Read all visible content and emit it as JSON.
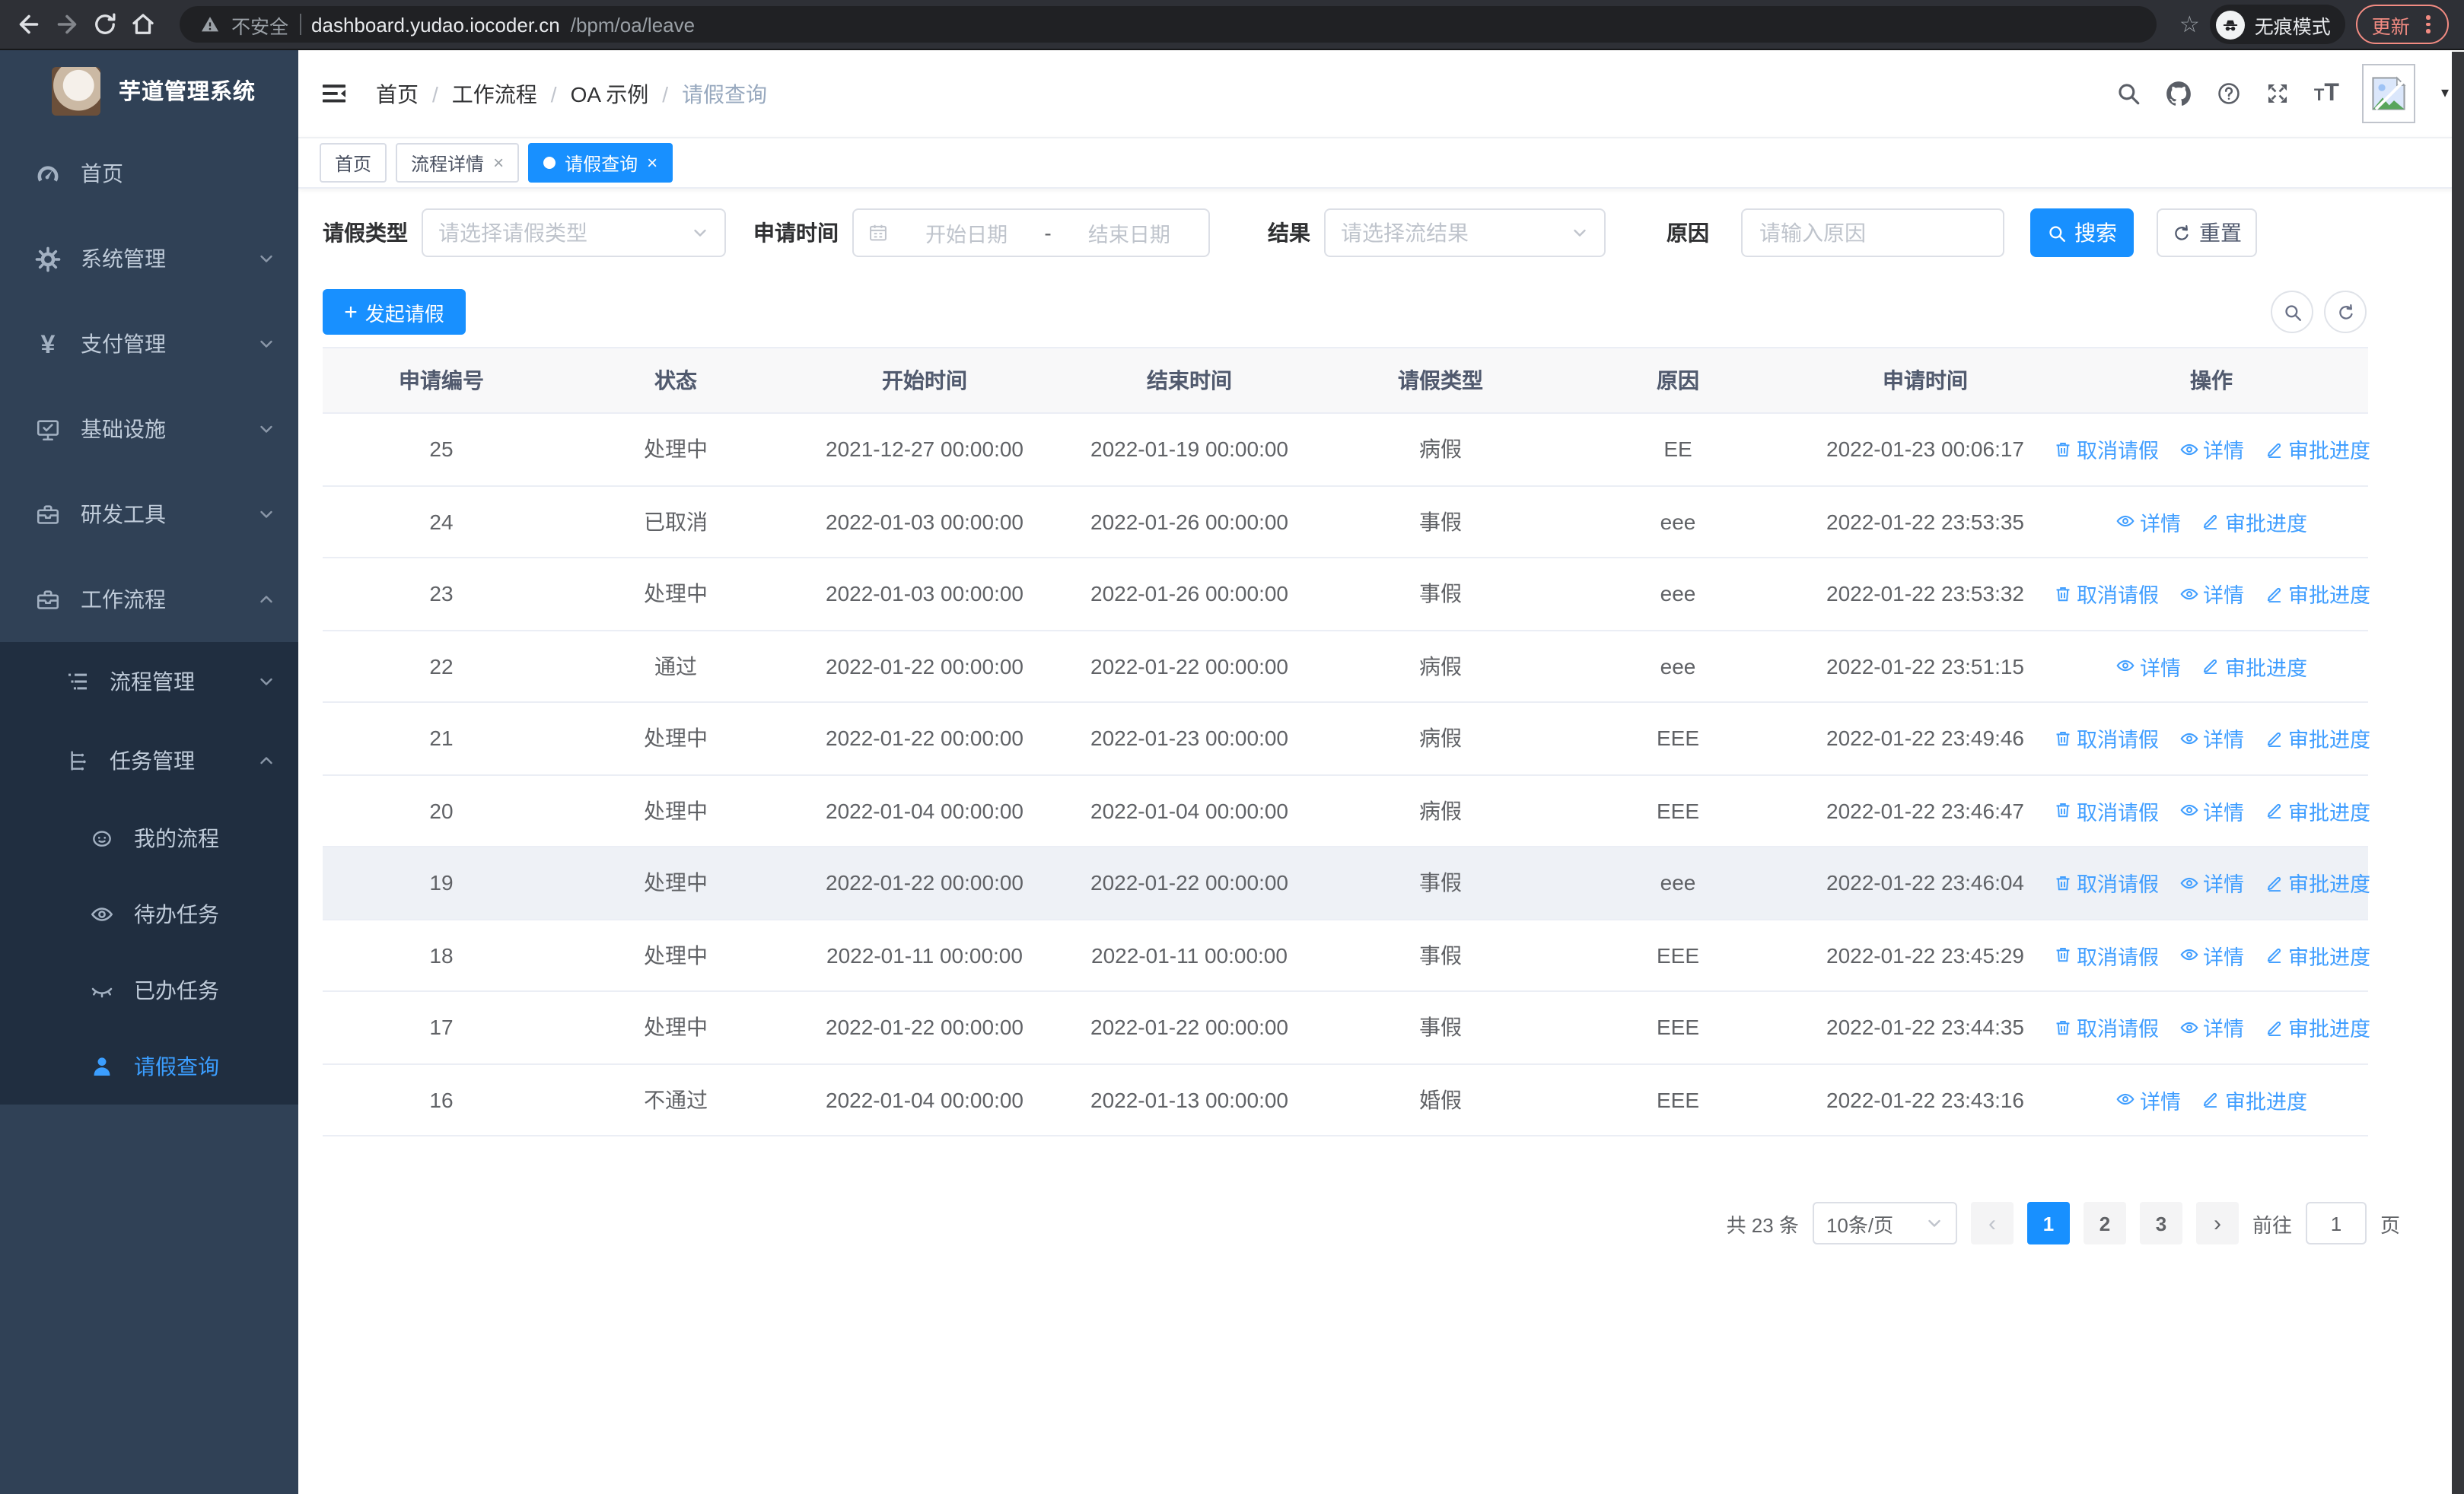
{
  "browser": {
    "security_label": "不安全",
    "url_host": "dashboard.yudao.iocoder.cn",
    "url_path": "/bpm/oa/leave",
    "incognito_label": "无痕模式",
    "update_label": "更新"
  },
  "glyphs": {
    "star": "☆",
    "yen": "¥",
    "plus": "+",
    "close": "×",
    "prev": "‹",
    "next": "›",
    "caret": "▾",
    "slash": "/",
    "font_small": "T",
    "font_big": "T"
  },
  "colors": {
    "accent": "#1890ff",
    "link": "#409eff",
    "update": "#f28b82",
    "sidebar_bg": "#304156",
    "submenu_bg": "#202e40"
  },
  "sidebar": {
    "app_title": "芋道管理系统",
    "items": [
      {
        "key": "home",
        "label": "首页",
        "icon": "dashboard"
      },
      {
        "key": "system-management",
        "label": "系统管理",
        "icon": "gear",
        "chevron": "down"
      },
      {
        "key": "payment-management",
        "label": "支付管理",
        "icon": "yen",
        "chevron": "down"
      },
      {
        "key": "infrastructure",
        "label": "基础设施",
        "icon": "monitor",
        "chevron": "down"
      },
      {
        "key": "dev-tools",
        "label": "研发工具",
        "icon": "toolbox",
        "chevron": "down"
      },
      {
        "key": "workflow",
        "label": "工作流程",
        "icon": "toolbox",
        "chevron": "up",
        "children": [
          {
            "key": "process-management",
            "label": "流程管理",
            "icon": "tree",
            "chevron": "down"
          },
          {
            "key": "task-management",
            "label": "任务管理",
            "icon": "flow",
            "chevron": "up",
            "children": [
              {
                "key": "my-process",
                "label": "我的流程",
                "icon": "face"
              },
              {
                "key": "todo-tasks",
                "label": "待办任务",
                "icon": "eye"
              },
              {
                "key": "done-tasks",
                "label": "已办任务",
                "icon": "eye-closed"
              },
              {
                "key": "leave-query",
                "label": "请假查询",
                "icon": "user",
                "active": true
              }
            ]
          }
        ]
      }
    ]
  },
  "header": {
    "breadcrumb": [
      "首页",
      "工作流程",
      "OA 示例",
      "请假查询"
    ]
  },
  "tabs": [
    {
      "key": "home",
      "label": "首页",
      "closable": false,
      "active": false
    },
    {
      "key": "process-detail",
      "label": "流程详情",
      "closable": true,
      "active": false
    },
    {
      "key": "leave-query",
      "label": "请假查询",
      "closable": true,
      "active": true
    }
  ],
  "filters": {
    "type_label": "请假类型",
    "type_placeholder": "请选择请假类型",
    "time_label": "申请时间",
    "start_placeholder": "开始日期",
    "range_separator": "-",
    "end_placeholder": "结束日期",
    "result_label": "结果",
    "result_placeholder": "请选择流结果",
    "reason_label": "原因",
    "reason_placeholder": "请输入原因",
    "search_label": "搜索",
    "reset_label": "重置"
  },
  "toolbar": {
    "create_label": "发起请假"
  },
  "table": {
    "columns": [
      "申请编号",
      "状态",
      "开始时间",
      "结束时间",
      "请假类型",
      "原因",
      "申请时间",
      "操作"
    ],
    "action_labels": {
      "cancel": "取消请假",
      "detail": "详情",
      "progress": "审批进度"
    },
    "rows": [
      {
        "id": "25",
        "status": "处理中",
        "start": "2021-12-27 00:00:00",
        "end": "2022-01-19 00:00:00",
        "type": "病假",
        "reason": "EE",
        "apply_time": "2022-01-23 00:06:17",
        "actions": [
          "cancel",
          "detail",
          "progress"
        ],
        "hover": false
      },
      {
        "id": "24",
        "status": "已取消",
        "start": "2022-01-03 00:00:00",
        "end": "2022-01-26 00:00:00",
        "type": "事假",
        "reason": "eee",
        "apply_time": "2022-01-22 23:53:35",
        "actions": [
          "detail",
          "progress"
        ],
        "hover": false
      },
      {
        "id": "23",
        "status": "处理中",
        "start": "2022-01-03 00:00:00",
        "end": "2022-01-26 00:00:00",
        "type": "事假",
        "reason": "eee",
        "apply_time": "2022-01-22 23:53:32",
        "actions": [
          "cancel",
          "detail",
          "progress"
        ],
        "hover": false
      },
      {
        "id": "22",
        "status": "通过",
        "start": "2022-01-22 00:00:00",
        "end": "2022-01-22 00:00:00",
        "type": "病假",
        "reason": "eee",
        "apply_time": "2022-01-22 23:51:15",
        "actions": [
          "detail",
          "progress"
        ],
        "hover": false
      },
      {
        "id": "21",
        "status": "处理中",
        "start": "2022-01-22 00:00:00",
        "end": "2022-01-23 00:00:00",
        "type": "病假",
        "reason": "EEE",
        "apply_time": "2022-01-22 23:49:46",
        "actions": [
          "cancel",
          "detail",
          "progress"
        ],
        "hover": false
      },
      {
        "id": "20",
        "status": "处理中",
        "start": "2022-01-04 00:00:00",
        "end": "2022-01-04 00:00:00",
        "type": "病假",
        "reason": "EEE",
        "apply_time": "2022-01-22 23:46:47",
        "actions": [
          "cancel",
          "detail",
          "progress"
        ],
        "hover": false
      },
      {
        "id": "19",
        "status": "处理中",
        "start": "2022-01-22 00:00:00",
        "end": "2022-01-22 00:00:00",
        "type": "事假",
        "reason": "eee",
        "apply_time": "2022-01-22 23:46:04",
        "actions": [
          "cancel",
          "detail",
          "progress"
        ],
        "hover": true
      },
      {
        "id": "18",
        "status": "处理中",
        "start": "2022-01-11 00:00:00",
        "end": "2022-01-11 00:00:00",
        "type": "事假",
        "reason": "EEE",
        "apply_time": "2022-01-22 23:45:29",
        "actions": [
          "cancel",
          "detail",
          "progress"
        ],
        "hover": false
      },
      {
        "id": "17",
        "status": "处理中",
        "start": "2022-01-22 00:00:00",
        "end": "2022-01-22 00:00:00",
        "type": "事假",
        "reason": "EEE",
        "apply_time": "2022-01-22 23:44:35",
        "actions": [
          "cancel",
          "detail",
          "progress"
        ],
        "hover": false
      },
      {
        "id": "16",
        "status": "不通过",
        "start": "2022-01-04 00:00:00",
        "end": "2022-01-13 00:00:00",
        "type": "婚假",
        "reason": "EEE",
        "apply_time": "2022-01-22 23:43:16",
        "actions": [
          "detail",
          "progress"
        ],
        "hover": false
      }
    ]
  },
  "pagination": {
    "total_label": "共 23 条",
    "page_size": "10条/页",
    "pages": [
      "1",
      "2",
      "3"
    ],
    "active_page": "1",
    "goto_label": "前往",
    "goto_value": "1",
    "page_unit": "页"
  }
}
